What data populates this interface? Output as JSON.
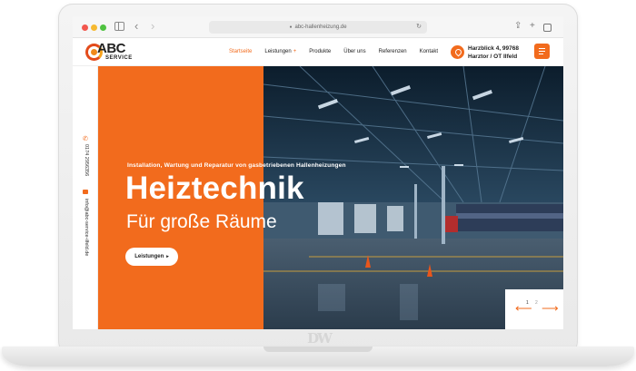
{
  "browser": {
    "url": "abc-hallenheizung.de"
  },
  "brand": {
    "abc": "ABC",
    "service": "SERVICE"
  },
  "nav": {
    "items": [
      {
        "label": "Startseite",
        "active": true
      },
      {
        "label": "Leistungen",
        "dropdown": true
      },
      {
        "label": "Produkte"
      },
      {
        "label": "Über uns"
      },
      {
        "label": "Referenzen"
      },
      {
        "label": "Kontakt"
      }
    ],
    "dropdown_caret": "+"
  },
  "address": {
    "line1": "Harzblick 4, 99768",
    "line2": "Harztor / OT Ilfeld"
  },
  "contact": {
    "phone": "0174 2956356",
    "email": "info@abc-service-ilfeld.de"
  },
  "hero": {
    "tagline": "Installation, Wartung und Reparatur von gasbetriebenen Hallenheizungen",
    "title": "Heiztechnik",
    "subtitle": "Für große Räume",
    "button_label": "Leistungen",
    "button_arrow": "▸"
  },
  "slider": {
    "prev": "⟵",
    "next": "⟶",
    "current": "1",
    "total": "2"
  },
  "colors": {
    "accent": "#f26b1d",
    "text": "#222222",
    "photo_dark": "#1f3c55"
  },
  "icons": {
    "share": "⇪",
    "plus": "+",
    "back": "‹",
    "forward": "›",
    "reload": "↻",
    "lock": "🔒",
    "phone": "✆"
  },
  "laptop_logo": "DW"
}
